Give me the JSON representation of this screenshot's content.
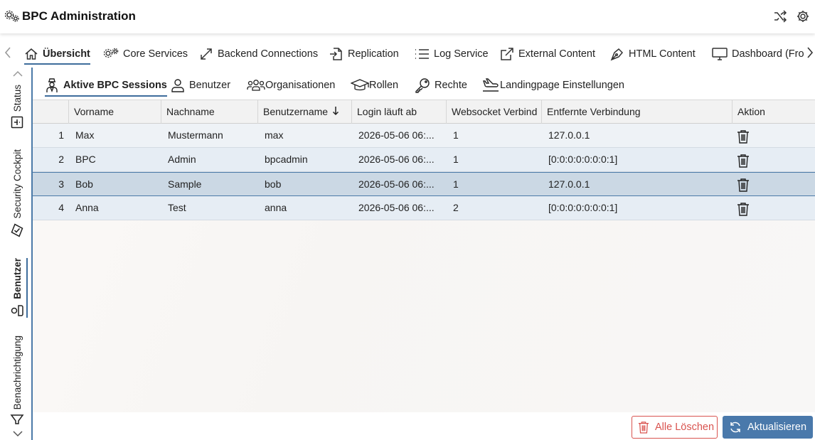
{
  "app": {
    "title": "BPC Administration"
  },
  "main_tabs": [
    {
      "label": "Übersicht",
      "icon": "home-icon",
      "active": true
    },
    {
      "label": "Core Services",
      "icon": "gears-icon"
    },
    {
      "label": "Backend Connections",
      "icon": "expand-arrows-icon"
    },
    {
      "label": "Replication",
      "icon": "file-import-icon"
    },
    {
      "label": "Log Service",
      "icon": "list-icon"
    },
    {
      "label": "External Content",
      "icon": "external-link-icon"
    },
    {
      "label": "HTML Content",
      "icon": "pen-nib-icon"
    },
    {
      "label": "Dashboard (Fron",
      "icon": "monitor-icon"
    }
  ],
  "side_tabs": [
    {
      "label": "Status",
      "icon": "info-icon"
    },
    {
      "label": "Security Cockpit",
      "icon": "shield-check-icon"
    },
    {
      "label": "Benutzer",
      "icon": "user-icon",
      "active": true
    },
    {
      "label": "Benachrichtigung",
      "icon": "megaphone-icon"
    }
  ],
  "sub_tabs": [
    {
      "label": "Aktive BPC Sessions",
      "icon": "user-secret-icon",
      "active": true
    },
    {
      "label": "Benutzer",
      "icon": "user-icon"
    },
    {
      "label": "Organisationen",
      "icon": "users-icon"
    },
    {
      "label": "Rollen",
      "icon": "graduation-cap-icon"
    },
    {
      "label": "Rechte",
      "icon": "key-icon"
    },
    {
      "label": "Landingpage Einstellungen",
      "icon": "plane-landing-icon"
    }
  ],
  "table": {
    "columns": [
      "Vorname",
      "Nachname",
      "Benutzername",
      "Login läuft ab",
      "Websocket Verbind",
      "Entfernte Verbindung",
      "Aktion"
    ],
    "sort_column": "Benutzername",
    "sort_direction": "descending",
    "rows": [
      {
        "num": "1",
        "vorname": "Max",
        "nachname": "Mustermann",
        "benutzername": "max",
        "login": "2026-05-06 06:...",
        "websocket": "1",
        "remote": "127.0.0.1"
      },
      {
        "num": "2",
        "vorname": "BPC",
        "nachname": "Admin",
        "benutzername": "bpcadmin",
        "login": "2026-05-06 06:...",
        "websocket": "1",
        "remote": "[0:0:0:0:0:0:0:1]"
      },
      {
        "num": "3",
        "vorname": "Bob",
        "nachname": "Sample",
        "benutzername": "bob",
        "login": "2026-05-06 06:...",
        "websocket": "1",
        "remote": "127.0.0.1",
        "selected": true
      },
      {
        "num": "4",
        "vorname": "Anna",
        "nachname": "Test",
        "benutzername": "anna",
        "login": "2026-05-06 06:...",
        "websocket": "2",
        "remote": "[0:0:0:0:0:0:0:1]"
      }
    ]
  },
  "buttons": {
    "delete_all": "Alle Löschen",
    "refresh": "Aktualisieren"
  },
  "colors": {
    "accent": "#4a79ab",
    "danger": "#d9534f",
    "row_selected": "#cbd8e4",
    "row_default": "#e6edf4"
  }
}
